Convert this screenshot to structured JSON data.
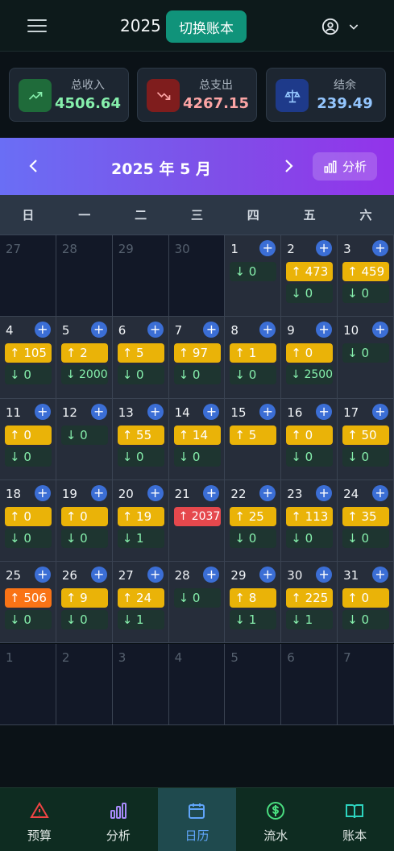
{
  "header": {
    "year": "2025",
    "switch_label": "切换账本"
  },
  "summary": {
    "income": {
      "label": "总收入",
      "value": "4506.64",
      "color": "#86efac"
    },
    "expense": {
      "label": "总支出",
      "value": "4267.15",
      "color": "#fca5a5"
    },
    "balance": {
      "label": "结余",
      "value": "239.49",
      "color": "#93c5fd"
    }
  },
  "calendar": {
    "month_title": "2025 年 5 月",
    "analysis_label": "分析",
    "weekdays": [
      "日",
      "一",
      "二",
      "三",
      "四",
      "五",
      "六"
    ],
    "cells": [
      {
        "day": "27",
        "out": true
      },
      {
        "day": "28",
        "out": true
      },
      {
        "day": "29",
        "out": true
      },
      {
        "day": "30",
        "out": true
      },
      {
        "day": "1",
        "exp": "↓ 0"
      },
      {
        "day": "2",
        "inc": "↑ 473",
        "exp": "↓ 0"
      },
      {
        "day": "3",
        "inc": "↑ 459",
        "exp": "↓ 0"
      },
      {
        "day": "4",
        "inc": "↑ 105",
        "exp": "↓ 0"
      },
      {
        "day": "5",
        "inc": "↑ 2",
        "exp": "↓ 2000",
        "expSmall": true
      },
      {
        "day": "6",
        "inc": "↑ 5",
        "exp": "↓ 0"
      },
      {
        "day": "7",
        "inc": "↑ 97",
        "exp": "↓ 0"
      },
      {
        "day": "8",
        "inc": "↑ 1",
        "exp": "↓ 0"
      },
      {
        "day": "9",
        "inc": "↑ 0",
        "exp": "↓ 2500",
        "expSmall": true
      },
      {
        "day": "10",
        "exp": "↓ 0"
      },
      {
        "day": "11",
        "inc": "↑ 0",
        "exp": "↓ 0"
      },
      {
        "day": "12",
        "exp": "↓ 0"
      },
      {
        "day": "13",
        "inc": "↑ 55",
        "exp": "↓ 0"
      },
      {
        "day": "14",
        "inc": "↑ 14",
        "exp": "↓ 0"
      },
      {
        "day": "15",
        "inc": "↑ 5"
      },
      {
        "day": "16",
        "inc": "↑ 0",
        "exp": "↓ 0"
      },
      {
        "day": "17",
        "inc": "↑ 50",
        "exp": "↓ 0"
      },
      {
        "day": "18",
        "inc": "↑ 0",
        "exp": "↓ 0"
      },
      {
        "day": "19",
        "inc": "↑ 0",
        "exp": "↓ 0"
      },
      {
        "day": "20",
        "inc": "↑ 19",
        "exp": "↓ 1"
      },
      {
        "day": "21",
        "inc": "↑ 2037",
        "incStyle": "red"
      },
      {
        "day": "22",
        "inc": "↑ 25",
        "exp": "↓ 0"
      },
      {
        "day": "23",
        "inc": "↑ 113",
        "exp": "↓ 0"
      },
      {
        "day": "24",
        "inc": "↑ 35",
        "exp": "↓ 0"
      },
      {
        "day": "25",
        "inc": "↑ 506",
        "incStyle": "orange",
        "exp": "↓ 0"
      },
      {
        "day": "26",
        "inc": "↑ 9",
        "exp": "↓ 0"
      },
      {
        "day": "27",
        "inc": "↑ 24",
        "exp": "↓ 1"
      },
      {
        "day": "28",
        "exp": "↓ 0"
      },
      {
        "day": "29",
        "inc": "↑ 8",
        "exp": "↓ 1"
      },
      {
        "day": "30",
        "inc": "↑ 225",
        "exp": "↓ 1"
      },
      {
        "day": "31",
        "inc": "↑ 0",
        "exp": "↓ 0"
      },
      {
        "day": "1",
        "out": true
      },
      {
        "day": "2",
        "out": true
      },
      {
        "day": "3",
        "out": true
      },
      {
        "day": "4",
        "out": true
      },
      {
        "day": "5",
        "out": true
      },
      {
        "day": "6",
        "out": true
      },
      {
        "day": "7",
        "out": true
      }
    ]
  },
  "nav": [
    {
      "label": "预算",
      "icon": "alert-triangle-icon",
      "color": "#ef4444"
    },
    {
      "label": "分析",
      "icon": "bar-chart-icon",
      "color": "#a78bfa"
    },
    {
      "label": "日历",
      "icon": "calendar-icon",
      "color": "#60a5fa",
      "active": true
    },
    {
      "label": "流水",
      "icon": "dollar-circle-icon",
      "color": "#4ade80"
    },
    {
      "label": "账本",
      "icon": "book-open-icon",
      "color": "#2dd4bf"
    }
  ]
}
